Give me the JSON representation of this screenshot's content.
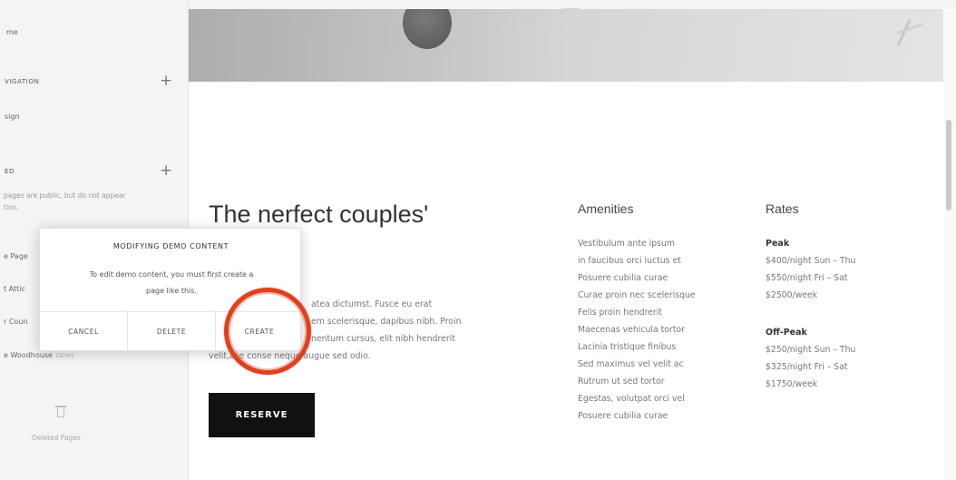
{
  "sidebar": {
    "top_item": "me",
    "nav_section": "VIGATION",
    "nav_item": "sign",
    "hidden_section": "ED",
    "hidden_desc_1": "pages are public, but do not appear",
    "hidden_desc_2": "tion.",
    "pages": [
      "e Page",
      "t Attic",
      "r Coun"
    ],
    "woodhouse": "e Woodhouse",
    "woodhouse_badge": "DEMO",
    "deleted_label": "Deleted Pages"
  },
  "page": {
    "title_line1": "The nerfect couples'",
    "title_line2": "/.",
    "body_lines": [
      "atea dictumst. Fusce eu erat",
      "em scelerisque, dapibus nibh. Proin",
      "nentum cursus, elit nibh hendrerit",
      "velit,ase conse neque augue sed odio."
    ],
    "reserve_label": "RESERVE"
  },
  "amenities": {
    "title": "Amenities",
    "items": [
      "Vestibulum ante ipsum",
      "in faucibus orci luctus et",
      "Posuere cubilia curae",
      "Curae proin nec scelerisque",
      "Felis proin hendrerit",
      "Maecenas vehicula tortor",
      "Lacinia tristique finibus",
      "Sed maximus vel velit ac",
      "Rutrum ut sed tortor",
      "Egestas, volutpat orci vel",
      "Posuere cubilia curae"
    ]
  },
  "rates": {
    "title": "Rates",
    "peak_label": "Peak",
    "peak": [
      "$400/night Sun – Thu",
      "$550/night Fri – Sat",
      "$2500/week"
    ],
    "offpeak_label": "Off-Peak",
    "offpeak": [
      "$250/night Sun – Thu",
      "$325/night Fri – Sat",
      "$1750/week"
    ]
  },
  "modal": {
    "title": "MODIFYING DEMO CONTENT",
    "body_line1": "To edit demo content, you must first create a",
    "body_line2": "page like this.",
    "cancel": "CANCEL",
    "delete": "DELETE",
    "create": "CREATE"
  },
  "colors": {
    "highlight": "#e0401e",
    "button_bg": "#111111"
  }
}
